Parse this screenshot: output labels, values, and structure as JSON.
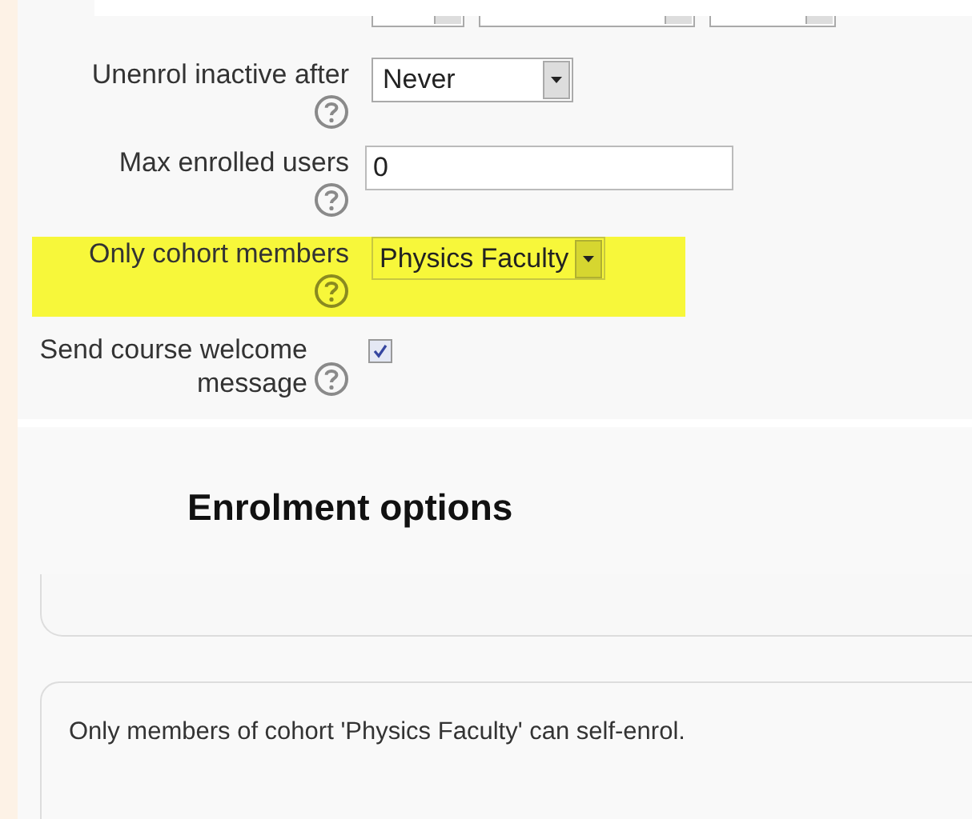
{
  "settings_form": {
    "fields": [
      {
        "kind": "select",
        "label": "Unenrol inactive after",
        "value": "Never",
        "highlighted": false
      },
      {
        "kind": "text",
        "label": "Max enrolled users",
        "value": "0",
        "highlighted": false
      },
      {
        "kind": "select",
        "label": "Only cohort members",
        "value": "Physics Faculty",
        "highlighted": true
      },
      {
        "kind": "checkbox",
        "label": "Send course welcome message",
        "checked": true,
        "highlighted": false
      }
    ]
  },
  "enrolment_page": {
    "heading": "Enrolment options",
    "notice": "Only members of cohort 'Physics Faculty' can self-enrol."
  }
}
